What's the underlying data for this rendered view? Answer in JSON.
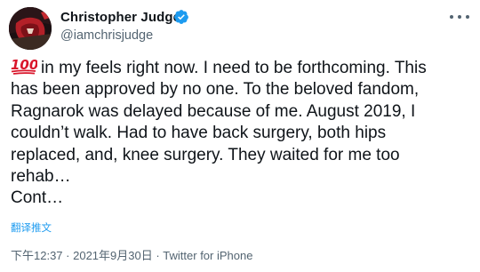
{
  "author": {
    "name": "Christopher Judge",
    "handle": "@iamchrisjudge",
    "verified": true,
    "avatar": "avatar-image"
  },
  "more_icon": "more-horizontal-icon",
  "tweet": {
    "emoji": "hundred-points-emoji",
    "lines": [
      "in my feels right now. I need to be forthcoming. This",
      "has been approved by no one. To the beloved fandom,",
      "Ragnarok was delayed because of me. August 2019, I",
      "couldn’t walk. Had to have back surgery, both hips",
      "replaced, and, knee surgery. They waited for me too",
      "rehab…",
      "Cont…"
    ]
  },
  "translate_label": "翻译推文",
  "meta": {
    "time": "下午12:37",
    "separator": " · ",
    "date": "2021年9月30日",
    "source": "Twitter for iPhone"
  },
  "colors": {
    "text": "#0f1419",
    "secondary": "#536471",
    "link": "#1d9bf0",
    "verified": "#1d9bf0",
    "emoji_red": "#d9162b"
  }
}
